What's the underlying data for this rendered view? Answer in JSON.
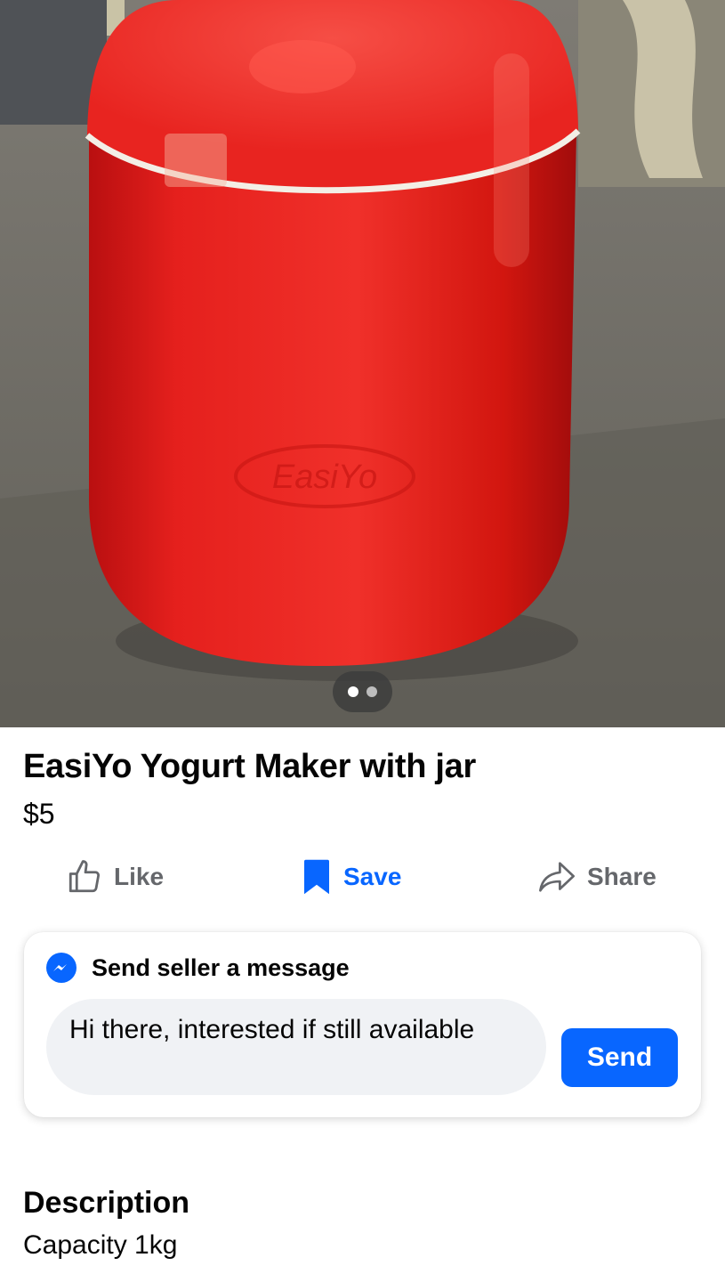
{
  "listing": {
    "title": "EasiYo Yogurt Maker with jar",
    "price": "$5",
    "photo_brand_embossed": "EasiYo",
    "photo_pager": {
      "total": 2,
      "current": 1
    }
  },
  "actions": {
    "like_label": "Like",
    "save_label": "Save",
    "share_label": "Share"
  },
  "message": {
    "header": "Send seller a message",
    "input_value": "Hi there, interested if still available",
    "send_label": "Send"
  },
  "description": {
    "heading": "Description",
    "text": "Capacity 1kg"
  },
  "icons": {
    "like": "thumbs-up-icon",
    "save": "bookmark-icon",
    "share": "share-arrow-icon",
    "messenger": "messenger-icon"
  },
  "colors": {
    "accent": "#0866ff",
    "secondary_text": "#65676b",
    "input_bg": "#f0f2f5",
    "product_red": "#e8201d"
  }
}
